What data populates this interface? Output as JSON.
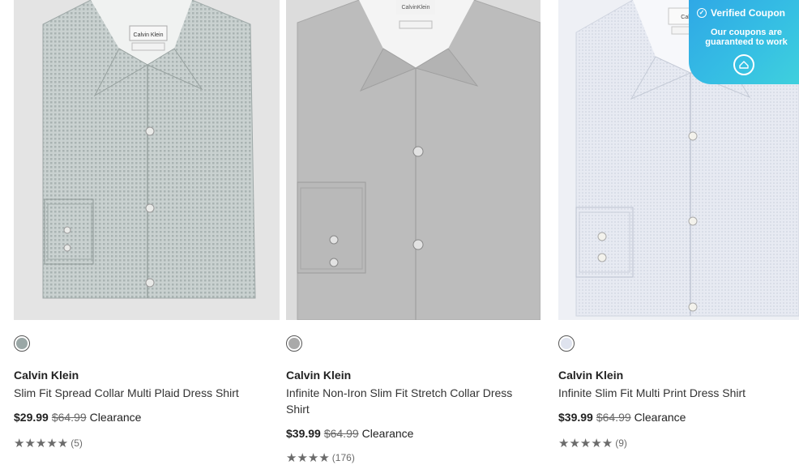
{
  "products": [
    {
      "brand": "Calvin Klein",
      "title": "Slim Fit Spread Collar Multi Plaid Dress Shirt",
      "price": "$29.99",
      "original_price": "$64.99",
      "status": "Clearance",
      "rating_stars": "★★★★★",
      "rating_count": "(5)",
      "label_text": "Calvin Klein",
      "swatch_color": "#9aa7a6"
    },
    {
      "brand": "Calvin Klein",
      "title": "Infinite Non-Iron Slim Fit Stretch Collar Dress Shirt",
      "price": "$39.99",
      "original_price": "$64.99",
      "status": "Clearance",
      "rating_stars": "★★★★",
      "rating_count": "(176)",
      "label_text": "CalvinKlein",
      "swatch_color": "#a9a9a9"
    },
    {
      "brand": "Calvin Klein",
      "title": "Infinite Slim Fit Multi Print Dress Shirt",
      "price": "$39.99",
      "original_price": "$64.99",
      "status": "Clearance",
      "rating_stars": "★★★★★",
      "rating_count": "(9)",
      "label_text": "Calvin",
      "swatch_color": "#dfe3ee"
    }
  ],
  "coupon": {
    "heading": "Verified Coupon",
    "subtext": "Our coupons are guaranteed to work",
    "icon": "coupon-logo-icon"
  }
}
